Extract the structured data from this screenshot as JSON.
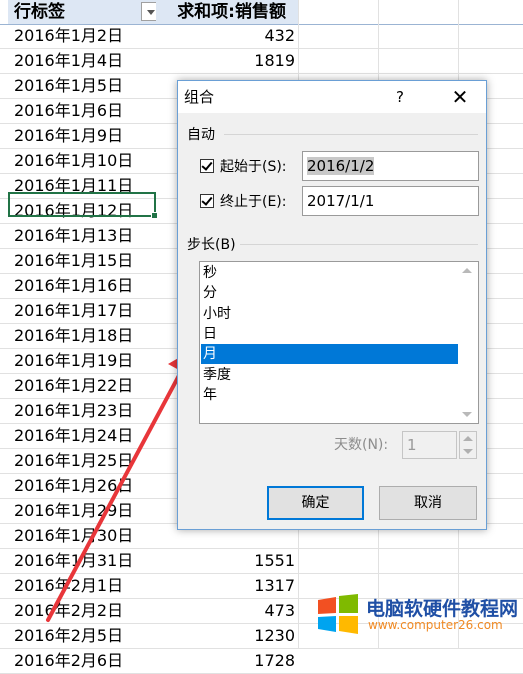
{
  "sheet": {
    "col_a_header": "行标签",
    "col_b_header": "求和项:销售额",
    "rows": [
      {
        "date": "2016年1月2日",
        "value": "432"
      },
      {
        "date": "2016年1月4日",
        "value": "1819"
      },
      {
        "date": "2016年1月5日",
        "value": ""
      },
      {
        "date": "2016年1月6日",
        "value": ""
      },
      {
        "date": "2016年1月9日",
        "value": ""
      },
      {
        "date": "2016年1月10日",
        "value": ""
      },
      {
        "date": "2016年1月11日",
        "value": ""
      },
      {
        "date": "2016年1月12日",
        "value": ""
      },
      {
        "date": "2016年1月13日",
        "value": ""
      },
      {
        "date": "2016年1月15日",
        "value": ""
      },
      {
        "date": "2016年1月16日",
        "value": ""
      },
      {
        "date": "2016年1月17日",
        "value": ""
      },
      {
        "date": "2016年1月18日",
        "value": ""
      },
      {
        "date": "2016年1月19日",
        "value": ""
      },
      {
        "date": "2016年1月22日",
        "value": ""
      },
      {
        "date": "2016年1月23日",
        "value": ""
      },
      {
        "date": "2016年1月24日",
        "value": ""
      },
      {
        "date": "2016年1月25日",
        "value": ""
      },
      {
        "date": "2016年1月26日",
        "value": ""
      },
      {
        "date": "2016年1月29日",
        "value": ""
      },
      {
        "date": "2016年1月30日",
        "value": ""
      },
      {
        "date": "2016年1月31日",
        "value": "1551"
      },
      {
        "date": "2016年2月1日",
        "value": "1317"
      },
      {
        "date": "2016年2月2日",
        "value": "473"
      },
      {
        "date": "2016年2月5日",
        "value": "1230"
      },
      {
        "date": "2016年2月6日",
        "value": "1728"
      }
    ]
  },
  "dialog": {
    "title": "组合",
    "help_label": "?",
    "close_label": "✕",
    "auto_section": "自动",
    "start_label": "起始于(S):",
    "start_value": "2016/1/2",
    "end_label": "终止于(E):",
    "end_value": "2017/1/1",
    "step_section": "步长(B)",
    "step_items": [
      "秒",
      "分",
      "小时",
      "日",
      "月",
      "季度",
      "年"
    ],
    "selected_step": "月",
    "days_label": "天数(N):",
    "days_value": "1",
    "ok_label": "确定",
    "cancel_label": "取消"
  },
  "watermark": {
    "title": "电脑软硬件教程网",
    "url": "www.computer26.com"
  },
  "colors": {
    "selection_blue": "#0078d7",
    "arrow_red": "#e8363a",
    "header_fill": "#dde7f4",
    "cell_border_green": "#217346"
  }
}
